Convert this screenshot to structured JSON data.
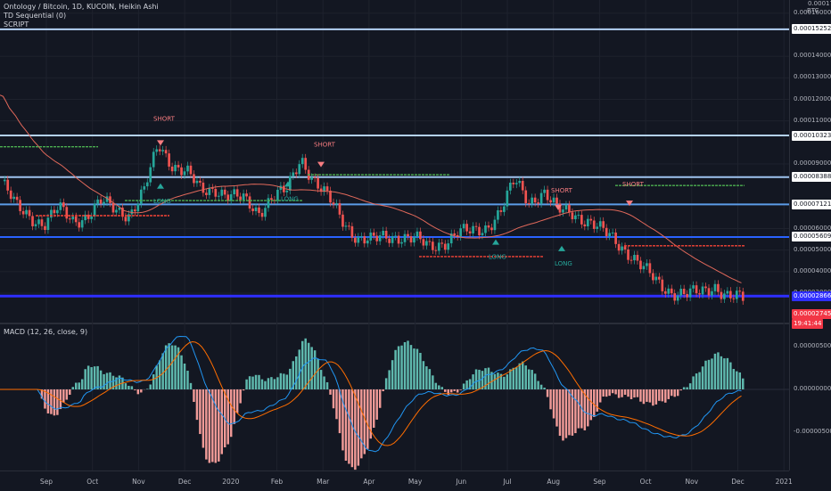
{
  "legend": {
    "main_title": "Ontology / Bitcoin, 1D, KUCOIN, Heikin Ashi",
    "indicator1": "TD Sequential (0)",
    "indicator2": "SCRIPT",
    "macd_title": "MACD (12, 26, close, 9)"
  },
  "axis": {
    "currency": "BTC",
    "top_label": "0.00017000",
    "price_ticks": [
      {
        "label": "0.00016000",
        "value": 0.00016
      },
      {
        "label": "0.00014000",
        "value": 0.00014
      },
      {
        "label": "0.00013000",
        "value": 0.00013
      },
      {
        "label": "0.00012000",
        "value": 0.00012
      },
      {
        "label": "0.00011000",
        "value": 0.00011
      },
      {
        "label": "0.00009000",
        "value": 9e-05
      },
      {
        "label": "0.00006000",
        "value": 6e-05
      },
      {
        "label": "0.00005000",
        "value": 5e-05
      },
      {
        "label": "0.00004000",
        "value": 4e-05
      },
      {
        "label": "0.00003000",
        "value": 3e-05
      }
    ],
    "macd_ticks": [
      {
        "label": "0.00000500",
        "value": 5e-06
      },
      {
        "label": "0.00000000",
        "value": 0
      },
      {
        "label": "-0.00000500",
        "value": -5e-06
      }
    ],
    "time_labels": [
      "Sep",
      "Oct",
      "Nov",
      "Dec",
      "2020",
      "Feb",
      "Mar",
      "Apr",
      "May",
      "Jun",
      "Jul",
      "Aug",
      "Sep",
      "Oct",
      "Nov",
      "Dec",
      "2021"
    ]
  },
  "levels": [
    {
      "label": "0.00015252",
      "value": 0.00015252,
      "color": "#b4d2f5",
      "thick": 2
    },
    {
      "label": "0.00010323",
      "value": 0.00010323,
      "color": "#b4d2f5",
      "thick": 2
    },
    {
      "label": "0.00008388",
      "value": 8.388e-05,
      "color": "#9ec3ef",
      "thick": 2
    },
    {
      "label": "0.00007121",
      "value": 7.121e-05,
      "color": "#5b9ce8",
      "thick": 2
    },
    {
      "label": "0.00005609",
      "value": 5.609e-05,
      "color": "#2962ff",
      "thick": 2
    },
    {
      "label": "0.00002866",
      "value": 2.866e-05,
      "color": "#2f2fff",
      "thick": 3
    }
  ],
  "price_tags": {
    "current_price": "0.00002745",
    "countdown": "19:41:44",
    "current_value": 2.745e-05,
    "colors": {
      "level_bg": "#ffffff",
      "level_text": "#131722",
      "current_bg": "#f23645",
      "current_text": "#ffffff",
      "blue_bg": "#2f2fff"
    }
  },
  "signals": [
    {
      "label": "SHORT",
      "type": "short",
      "x": "Nov"
    },
    {
      "label": "LONG",
      "type": "long",
      "x": "Nov"
    },
    {
      "label": "LONG",
      "type": "long",
      "x": "Feb"
    },
    {
      "label": "SHORT",
      "type": "short",
      "x": "Feb"
    },
    {
      "label": "LONG",
      "type": "long",
      "x": "Jun"
    },
    {
      "label": "SHORT",
      "type": "short",
      "x": "Aug"
    },
    {
      "label": "LONG",
      "type": "long",
      "x": "Aug"
    },
    {
      "label": "SHORT",
      "type": "short",
      "x": "Sep"
    }
  ],
  "colors": {
    "up": "#26a69a",
    "down": "#ef5350",
    "ma": "#e0685a",
    "macd_line": "#2196f3",
    "signal_line": "#ff6d00",
    "td_green": "#4caf50",
    "td_red": "#f44336"
  },
  "price_series": [
    8.2e-05,
    7e-05,
    6.6e-05,
    6.2e-05,
    6.9e-05,
    6.4e-05,
    6.6e-05,
    7.2e-05,
    6.9e-05,
    6.7e-05,
    7.7e-05,
    9.9e-05,
    9e-05,
    8.6e-05,
    7.7e-05,
    7.9e-05,
    7.5e-05,
    7.3e-05,
    6.8e-05,
    7.5e-05,
    7.7e-05,
    9.3e-05,
    8.2e-05,
    7.3e-05,
    6.3e-05,
    5.6e-05,
    5.4e-05,
    5.6e-05,
    5.7e-05,
    5.5e-05,
    5.1e-05,
    5.4e-05,
    5.8e-05,
    5.8e-05,
    6.1e-05,
    6.8e-05,
    8.2e-05,
    7.3e-05,
    7.7e-05,
    6.8e-05,
    6.8e-05,
    6.4e-05,
    5.9e-05,
    5.5e-05,
    4.9e-05,
    4.1e-05,
    3.5e-05,
    3.1e-05,
    2.9e-05,
    3e-05,
    3.4e-05,
    2.8e-05,
    2.7e-05
  ]
}
